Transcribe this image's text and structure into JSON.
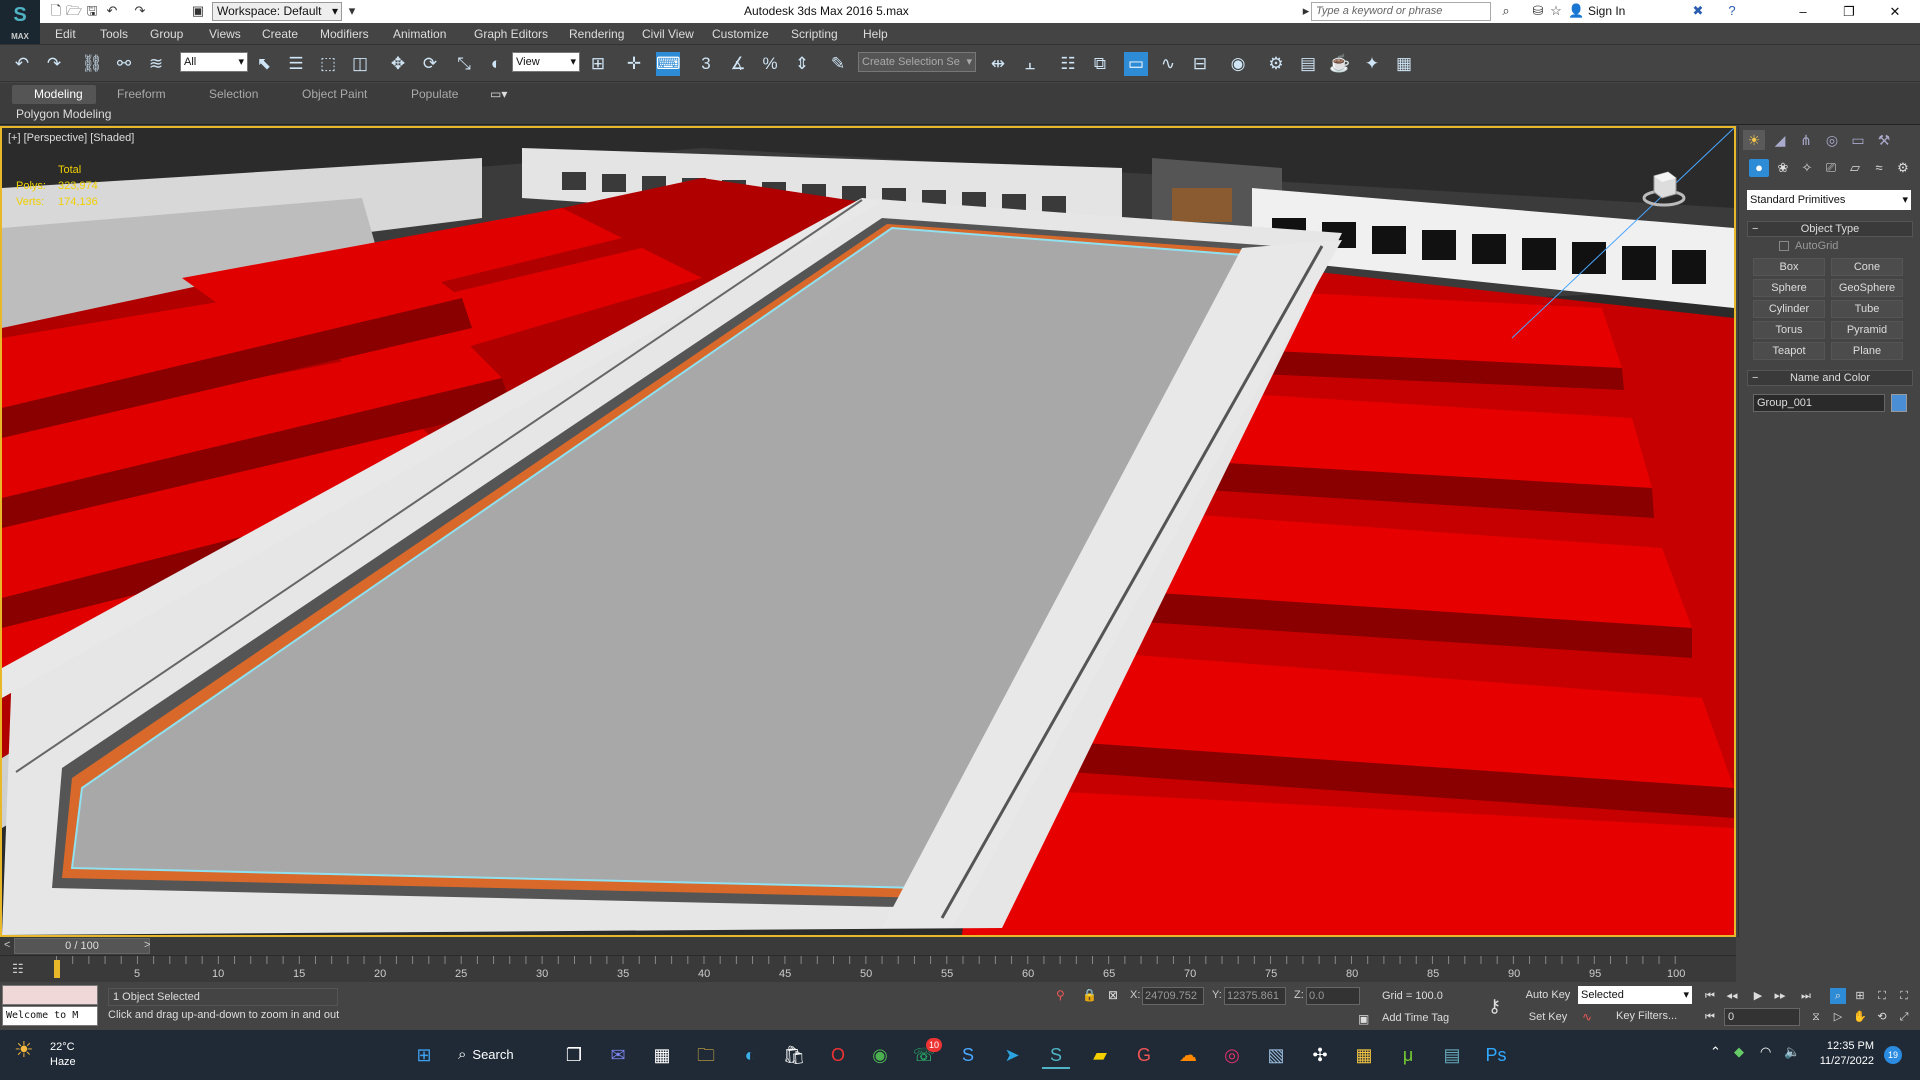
{
  "title": {
    "workspace": "Workspace: Default",
    "app_title": "Autodesk 3ds Max 2016     5.max",
    "search_placeholder": "Type a keyword or phrase",
    "sign_in": "Sign In",
    "logo_text": "MAX"
  },
  "menu": [
    "Edit",
    "Tools",
    "Group",
    "Views",
    "Create",
    "Modifiers",
    "Animation",
    "Graph Editors",
    "Rendering",
    "Civil View",
    "Customize",
    "Scripting",
    "Help"
  ],
  "toolbar": {
    "selection_filter": "All",
    "reference_coord": "View",
    "named_selection_placeholder": "Create Selection Se"
  },
  "ribbon": {
    "tabs": [
      "Modeling",
      "Freeform",
      "Selection",
      "Object Paint",
      "Populate"
    ],
    "active_tab": "Modeling",
    "sub_label": "Polygon Modeling"
  },
  "viewport": {
    "label": "[+] [Perspective] [Shaded]",
    "stats_header": "Total",
    "polys_label": "Polys:",
    "polys_value": "323,974",
    "verts_label": "Verts:",
    "verts_value": "174,136"
  },
  "command_panel": {
    "primitive_type": "Standard Primitives",
    "object_type_title": "Object Type",
    "autogrid_label": "AutoGrid",
    "buttons": [
      "Box",
      "Cone",
      "Sphere",
      "GeoSphere",
      "Cylinder",
      "Tube",
      "Torus",
      "Pyramid",
      "Teapot",
      "Plane"
    ],
    "name_color_title": "Name and Color",
    "object_name": "Group_001",
    "object_color": "#4a8fd6"
  },
  "timeline": {
    "frame_display": "0 / 100",
    "tick_labels": [
      "5",
      "10",
      "15",
      "20",
      "25",
      "30",
      "35",
      "40",
      "45",
      "50",
      "55",
      "60",
      "65",
      "70",
      "75",
      "80",
      "85",
      "90",
      "95",
      "100"
    ]
  },
  "status": {
    "maxscript_text": "Welcome to M",
    "selection_count": "1 Object Selected",
    "prompt": "Click and drag up-and-down to zoom in and out",
    "x_label": "X:",
    "x_value": "24709.752",
    "y_label": "Y:",
    "y_value": "12375.861",
    "z_label": "Z:",
    "z_value": "0.0",
    "grid": "Grid = 100.0",
    "add_time_tag": "Add Time Tag",
    "auto_key": "Auto Key",
    "set_key": "Set Key",
    "key_mode": "Selected",
    "key_filters": "Key Filters...",
    "current_frame": "0"
  },
  "taskbar": {
    "temperature": "22°C",
    "weather": "Haze",
    "search_label": "Search",
    "whatsapp_badge": "10",
    "time": "12:35 PM",
    "date": "11/27/2022",
    "notifications": "19"
  }
}
